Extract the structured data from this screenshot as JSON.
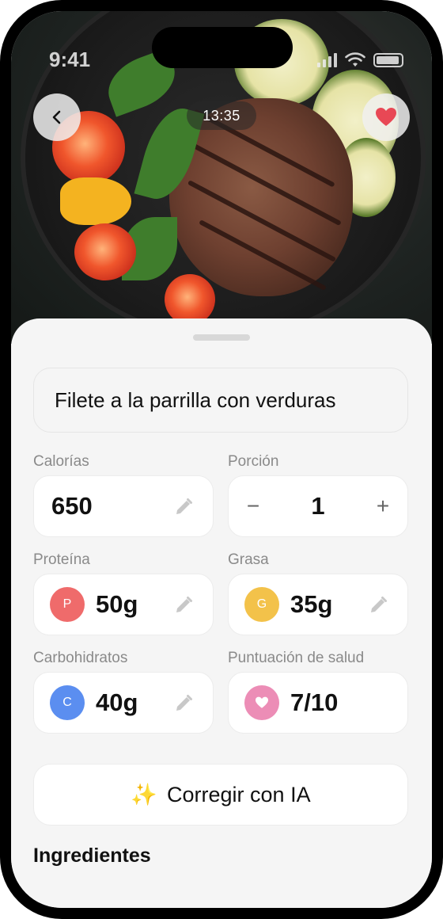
{
  "status": {
    "time": "9:41"
  },
  "media": {
    "duration": "13:35"
  },
  "food": {
    "name": "Filete a la parrilla con verduras"
  },
  "stats": {
    "calories": {
      "label": "Calorías",
      "value": "650"
    },
    "portion": {
      "label": "Porción",
      "value": "1",
      "minus": "−",
      "plus": "+"
    },
    "protein": {
      "label": "Proteína",
      "value": "50g",
      "badge": "P",
      "color": "#ef6b6b"
    },
    "fat": {
      "label": "Grasa",
      "value": "35g",
      "badge": "G",
      "color": "#f3c24a"
    },
    "carbs": {
      "label": "Carbohidratos",
      "value": "40g",
      "badge": "C",
      "color": "#5b8ef0"
    },
    "health": {
      "label": "Puntuación de salud",
      "value": "7/10",
      "color": "#ec8db6"
    }
  },
  "actions": {
    "fix_ai": {
      "icon": "✨",
      "label": "Corregir con IA"
    }
  },
  "sections": {
    "ingredients": "Ingredientes"
  },
  "icons": {
    "back": "chevron-left-icon",
    "favorite": "heart-icon",
    "edit": "pencil-icon"
  },
  "colors": {
    "favorite": "#e84855"
  }
}
